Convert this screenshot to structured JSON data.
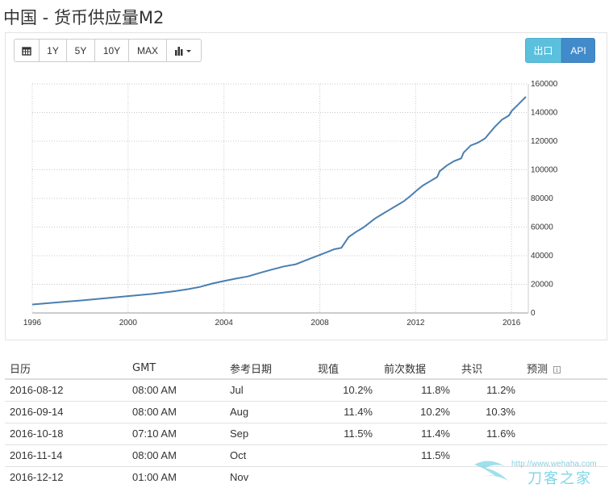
{
  "title": "中国 - 货币供应量M2",
  "toolbar": {
    "buttons": [
      {
        "name": "calendar-button",
        "label": "",
        "icon": "calendar-icon",
        "w": 32
      },
      {
        "name": "range-1y-button",
        "label": "1Y",
        "w": 35
      },
      {
        "name": "range-5y-button",
        "label": "5Y",
        "w": 36
      },
      {
        "name": "range-10y-button",
        "label": "10Y",
        "w": 43
      },
      {
        "name": "range-max-button",
        "label": "MAX",
        "w": 48
      },
      {
        "name": "chart-type-button",
        "label": "",
        "icon": "bar-chart-icon",
        "w": 44
      }
    ]
  },
  "actions": {
    "export_label": "出口",
    "api_label": "API",
    "export_color": "#5bc0de",
    "api_color": "#428bca"
  },
  "chart_data": {
    "type": "line",
    "title": "",
    "xlabel": "",
    "ylabel": "",
    "x_ticks": [
      "1996",
      "2000",
      "2004",
      "2008",
      "2012",
      "2016"
    ],
    "y_ticks": [
      "0",
      "20000",
      "40000",
      "60000",
      "80000",
      "100000",
      "120000",
      "140000",
      "160000"
    ],
    "xlim": [
      1996,
      2016.7
    ],
    "ylim": [
      0,
      160000
    ],
    "grid": true,
    "line_color": "#4a7fb0",
    "series": [
      {
        "values": [
          [
            1996.0,
            5900
          ],
          [
            1996.5,
            6600
          ],
          [
            1997.0,
            7300
          ],
          [
            1997.5,
            8000
          ],
          [
            1998.0,
            8700
          ],
          [
            1998.5,
            9400
          ],
          [
            1999.0,
            10200
          ],
          [
            1999.5,
            11000
          ],
          [
            2000.0,
            11800
          ],
          [
            2000.5,
            12500
          ],
          [
            2001.0,
            13300
          ],
          [
            2001.5,
            14300
          ],
          [
            2002.0,
            15400
          ],
          [
            2002.5,
            16600
          ],
          [
            2003.0,
            18200
          ],
          [
            2003.5,
            20500
          ],
          [
            2004.0,
            22300
          ],
          [
            2004.5,
            24000
          ],
          [
            2005.0,
            25500
          ],
          [
            2005.5,
            28000
          ],
          [
            2006.0,
            30300
          ],
          [
            2006.5,
            32500
          ],
          [
            2007.0,
            34000
          ],
          [
            2007.3,
            36000
          ],
          [
            2007.6,
            38000
          ],
          [
            2008.0,
            40500
          ],
          [
            2008.3,
            42500
          ],
          [
            2008.6,
            44500
          ],
          [
            2008.9,
            45500
          ],
          [
            2009.0,
            48000
          ],
          [
            2009.2,
            53000
          ],
          [
            2009.5,
            56500
          ],
          [
            2009.8,
            59500
          ],
          [
            2010.0,
            62000
          ],
          [
            2010.3,
            66000
          ],
          [
            2010.6,
            69000
          ],
          [
            2010.9,
            72000
          ],
          [
            2011.2,
            75000
          ],
          [
            2011.5,
            78000
          ],
          [
            2011.8,
            82000
          ],
          [
            2012.0,
            85000
          ],
          [
            2012.3,
            89000
          ],
          [
            2012.6,
            92000
          ],
          [
            2012.9,
            95000
          ],
          [
            2013.0,
            99000
          ],
          [
            2013.3,
            103000
          ],
          [
            2013.6,
            106000
          ],
          [
            2013.9,
            108000
          ],
          [
            2014.0,
            112000
          ],
          [
            2014.3,
            117000
          ],
          [
            2014.6,
            119000
          ],
          [
            2014.9,
            122000
          ],
          [
            2015.0,
            124000
          ],
          [
            2015.3,
            130000
          ],
          [
            2015.6,
            135000
          ],
          [
            2015.9,
            138000
          ],
          [
            2016.0,
            141000
          ],
          [
            2016.3,
            146000
          ],
          [
            2016.6,
            151000
          ]
        ]
      }
    ]
  },
  "table": {
    "headers": [
      "日历",
      "GMT",
      "参考日期",
      "现值",
      "前次数据",
      "共识",
      "预测"
    ],
    "info_icon": "info-icon",
    "rows": [
      {
        "date": "2016-08-12",
        "gmt": "08:00 AM",
        "ref": "Jul",
        "actual": "10.2%",
        "previous": "11.8%",
        "consensus": "11.2%",
        "forecast": ""
      },
      {
        "date": "2016-09-14",
        "gmt": "08:00 AM",
        "ref": "Aug",
        "actual": "11.4%",
        "previous": "10.2%",
        "consensus": "10.3%",
        "forecast": ""
      },
      {
        "date": "2016-10-18",
        "gmt": "07:10 AM",
        "ref": "Sep",
        "actual": "11.5%",
        "previous": "11.4%",
        "consensus": "11.6%",
        "forecast": ""
      },
      {
        "date": "2016-11-14",
        "gmt": "08:00 AM",
        "ref": "Oct",
        "actual": "",
        "previous": "11.5%",
        "consensus": "",
        "forecast": ""
      },
      {
        "date": "2016-12-12",
        "gmt": "01:00 AM",
        "ref": "Nov",
        "actual": "",
        "previous": "",
        "consensus": "",
        "forecast": ""
      }
    ]
  },
  "watermark": {
    "url": "http://www.wehaha.com",
    "brand": "刀客之家"
  }
}
